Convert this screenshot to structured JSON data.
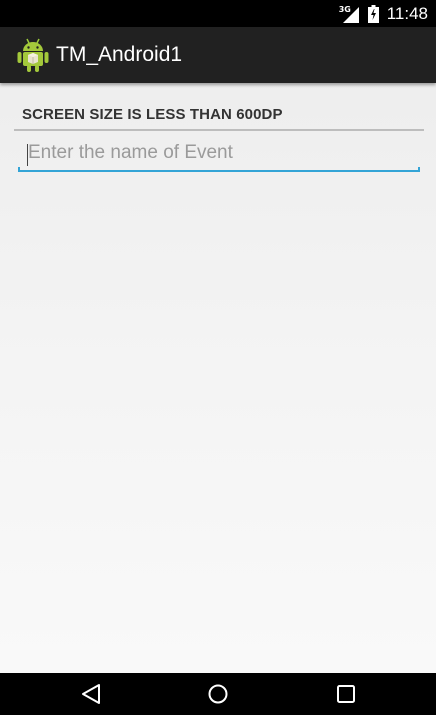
{
  "status_bar": {
    "network_label": "3G",
    "time": "11:48",
    "icons": [
      "signal-icon",
      "battery-icon"
    ]
  },
  "action_bar": {
    "title": "TM_Android1",
    "icon": "android-icon"
  },
  "content": {
    "section_header": "SCREEN SIZE IS LESS THAN 600DP",
    "event_input": {
      "value": "",
      "placeholder": "Enter the name of Event"
    }
  },
  "nav_bar": {
    "buttons": [
      "back-icon",
      "home-icon",
      "recents-icon"
    ]
  },
  "colors": {
    "accent": "#33a4d6",
    "action_bar": "#212121",
    "status_bar": "#000000"
  }
}
